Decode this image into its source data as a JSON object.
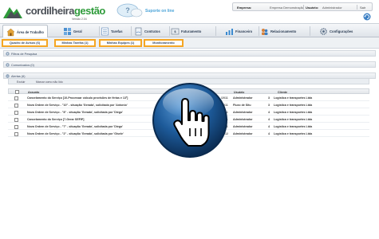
{
  "brand": {
    "name_a": "cordilheira",
    "name_b": "gestão",
    "subtitle": "Versão 2.04"
  },
  "support": {
    "label": "Suporte on line"
  },
  "userbar": {
    "company_label": "Empresa:",
    "company_value": "Empresa Demonstração",
    "user_label": "Usuário:",
    "user_value": "Administrador",
    "logout": "Sair"
  },
  "nav": [
    {
      "label": "Área de Trabalho",
      "icon": "home-icon"
    },
    {
      "label": "Geral",
      "icon": "grid-icon"
    },
    {
      "label": "Tarefas",
      "icon": "tasks-icon"
    },
    {
      "label": "Contratos",
      "icon": "contracts-icon"
    },
    {
      "label": "Faturamento",
      "icon": "invoice-icon"
    },
    {
      "label": "Financeiro",
      "icon": "finance-icon"
    },
    {
      "label": "Relacionamento",
      "icon": "people-icon"
    },
    {
      "label": "Configurações",
      "icon": "settings-icon"
    }
  ],
  "subtabs": [
    {
      "label": "Quadro de Avisos (6)"
    },
    {
      "label": "Minhas Tarefas (1)"
    },
    {
      "label": "Minhas Equipes (1)"
    },
    {
      "label": "Monitoramento"
    }
  ],
  "sections": {
    "filters": "Filtros de Pesquisa",
    "comments": "Comunicados (0)",
    "alerts": "Alertas (6)"
  },
  "toolbar": {
    "delete": "Excluir",
    "mark_read": "Marcar como não lido"
  },
  "table": {
    "headers": {
      "subject": "Assunto",
      "user": "Usuário",
      "client": "Cliente"
    },
    "rows": [
      {
        "desc": "Cancelamento do Serviço [10-Processar cálculo provisões de férias e 13º]",
        "date": "/2011",
        "user": "Administrador",
        "num": "3",
        "client": "Logística e transportes Ltda"
      },
      {
        "desc": "Nova Ordem de Serviço - \"10\" - situação 'Gerada', solicitada por 'Antonio'",
        "date": "/2011",
        "user": "Fluxo de Situ",
        "num": "3",
        "client": "Logística e transportes Ltda"
      },
      {
        "desc": "Nova Ordem de Serviço - \"8\" - situação 'Gerada', solicitada por 'Diego'",
        "date": "/2011",
        "user": "Administrador",
        "num": "4",
        "client": "Logística e transportes Ltda"
      },
      {
        "desc": "Cancelamento do Serviço [7-Gerar SEFIP]",
        "date": "/2011",
        "user": "Administrador",
        "num": "4",
        "client": "Logística e transportes Ltda"
      },
      {
        "desc": "Nova Ordem de Serviço - \"7\" - situação 'Gerada', solicitada por 'Diego'",
        "date": "/2011",
        "user": "Administrador",
        "num": "4",
        "client": "Logística e transportes Ltda"
      },
      {
        "desc": "Nova Ordem de Serviço - \"2\" - situação 'Gerada', solicitada por 'Gisele'",
        "date": "/2012",
        "user": "Administrador",
        "num": "4",
        "client": "Logística e transportes Ltda"
      }
    ]
  },
  "colors": {
    "accent_orange": "#f5a623",
    "brand_green": "#2e9b3a",
    "support_blue": "#4aa3d8",
    "overlay_blue": "#1a4f86"
  }
}
